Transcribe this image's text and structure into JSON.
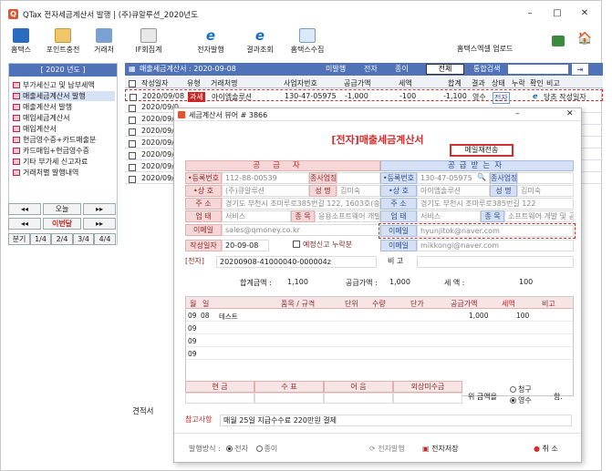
{
  "window": {
    "title": "QTax 전자세금계산서 발행 | (주)큐알루션_2020년도",
    "minimize": "–",
    "maximize": "□",
    "close": "✕"
  },
  "toolbar": {
    "items": [
      {
        "label": "홈택스",
        "icon": "hometax-icon"
      },
      {
        "label": "포인트충전",
        "icon": "point-charge-icon"
      },
      {
        "label": "거래처",
        "icon": "partner-icon"
      },
      {
        "label": "IF회집계",
        "icon": "aggregate-icon"
      },
      {
        "label": "전자발행",
        "icon": "e-issue-icon"
      },
      {
        "label": "결과조회",
        "icon": "result-query-icon"
      },
      {
        "label": "홈택스수집",
        "icon": "hometax-collect-icon"
      }
    ],
    "excel_upload": "홈택스엑셀 업로드",
    "home": "🏠"
  },
  "sidebar": {
    "year": "[ 2020 년도 ]",
    "items": [
      "부가세신고 및 납부세액",
      "매출세금계산서 발행",
      "매출계산서 발행",
      "매입세금계산서",
      "매입계산서",
      "현금영수증+카드매출분",
      "카드매입+현금영수증",
      "기타 부가세 신고자료",
      "거래처별 발행내역"
    ],
    "date_nav": {
      "prev": "◂◂",
      "today": "오늘",
      "next": "▸▸",
      "prev_month": "◂◂",
      "this_month": "이번달",
      "next_month": "▸▸",
      "quarters": [
        "분기",
        "1/4",
        "2/4",
        "3/4",
        "4/4"
      ]
    }
  },
  "list": {
    "header": "매출세금계산서 : 2020-09-08",
    "status_labels": [
      "미발행",
      "전자",
      "종이"
    ],
    "filter_selected": "전체",
    "search_label": "통합검색",
    "search_btn": "⇥",
    "columns": [
      "작성일자",
      "유형",
      "거래처명",
      "사업자번호",
      "공급가액",
      "세액",
      "합계",
      "결과",
      "상태",
      "누락",
      "확인",
      "비고"
    ],
    "rows": [
      {
        "date": "2020/09/08",
        "type": "과세",
        "partner": "아이엠솔루션",
        "bizno": "130-47-05975",
        "supply": "-1,000",
        "tax": "-100",
        "total": "-1,100",
        "result": "영수",
        "state": "전자",
        "note": "당초 작성일자"
      },
      {
        "date": "2020/09/0",
        "type": "",
        "partner": "",
        "bizno": "",
        "supply": "",
        "tax": "",
        "total": "",
        "result": "",
        "state": "",
        "note": ""
      },
      {
        "date": "2020/09/0",
        "type": "",
        "partner": "",
        "bizno": "",
        "supply": "",
        "tax": "",
        "total": "",
        "result": "",
        "state": "",
        "note": ""
      },
      {
        "date": "2020/09/0",
        "type": "",
        "partner": "",
        "bizno": "",
        "supply": "",
        "tax": "",
        "total": "",
        "result": "",
        "state": "",
        "note": ""
      },
      {
        "date": "2020/09/0",
        "type": "",
        "partner": "",
        "bizno": "",
        "supply": "",
        "tax": "",
        "total": "",
        "result": "",
        "state": "",
        "note": ""
      },
      {
        "date": "2020/09/0",
        "type": "",
        "partner": "",
        "bizno": "",
        "supply": "",
        "tax": "",
        "total": "",
        "result": "",
        "state": "",
        "note": ""
      },
      {
        "date": "2020/09/0",
        "type": "",
        "partner": "",
        "bizno": "",
        "supply": "",
        "tax": "",
        "total": "",
        "result": "",
        "state": "",
        "note": ""
      },
      {
        "date": "2020/09/0",
        "type": "",
        "partner": "",
        "bizno": "",
        "supply": "",
        "tax": "",
        "total": "",
        "result": "",
        "state": "",
        "note": ""
      }
    ],
    "footer_label": "견적서"
  },
  "viewer": {
    "title": "세금계산서 뷰어 # 3866",
    "heading": "[전자]매출세금계산서",
    "resend": "메일재전송",
    "supplier_header": "공급자",
    "buyer_header": "공급받는자",
    "supplier": {
      "regno_label": "•등록번호",
      "regno": "112-88-00539",
      "subno_label": "종사업장",
      "name_label": "•상 호",
      "name": "(주)큐알루션",
      "ceo_label": "성 명",
      "ceo": "김미숙",
      "addr_label": "주 소",
      "addr": "경기도 부천시 조마루로385번길 122, 1603호(송의동",
      "biz_label": "업 태",
      "biz": "서비스",
      "item_label": "종 목",
      "item": "응용소프트웨어 개발",
      "email_label": "이메일",
      "email": "sales@qmoney.co.kr"
    },
    "buyer": {
      "regno_label": "•등록번호",
      "regno": "130-47-05975",
      "subno_label": "종사업장",
      "name_label": "•상 호",
      "name": "아이엠솔루션",
      "ceo_label": "성 명",
      "ceo": "김미숙",
      "addr_label": "주 소",
      "addr": "경기도 부천시 조마루로385번길 122",
      "biz_label": "업 태",
      "biz": "서비스",
      "item_label": "종 목",
      "item": "소프트웨어 개발 및 공",
      "email1_label": "이메일",
      "email1": "hyunjitok@naver.com",
      "email2_label": "이메일",
      "email2": "mikkongi@naver.com"
    },
    "write_date_label": "작성일자",
    "write_date": "20-09-08",
    "reserve_label": "예정신고 누락분",
    "doc_label": "[전자]",
    "doc_no": "20200908-41000040-000004z",
    "remark_label": "비 고",
    "summary": {
      "total_label": "합계금액 :",
      "total": "1,100",
      "supply_label": "공급가액 :",
      "supply": "1,000",
      "tax_label": "세 액 :",
      "tax": "100"
    },
    "item_columns": [
      "월",
      "일",
      "품목 / 규격",
      "단위",
      "수량",
      "단가",
      "공급가액",
      "세액",
      "비고"
    ],
    "items": [
      {
        "m": "09",
        "d": "08",
        "name": "테스트",
        "supply": "1,000",
        "tax": "100"
      },
      {
        "m": "09",
        "d": "",
        "name": "",
        "supply": "",
        "tax": ""
      },
      {
        "m": "09",
        "d": "",
        "name": "",
        "supply": "",
        "tax": ""
      },
      {
        "m": "09",
        "d": "",
        "name": "",
        "supply": "",
        "tax": ""
      }
    ],
    "pay_columns": [
      "현 금",
      "수 표",
      "어 음",
      "외상미수금"
    ],
    "amount_label": "위 금액을",
    "claim": "청구",
    "receipt": "영수",
    "ham": "함.",
    "memo_label": "참고사항",
    "memo": "매월 25일 지급수수료 220만원 결제",
    "method_label": "발행방식 :",
    "method_electronic": "전자",
    "method_paper": "종이",
    "btn_e_issue": "전자발행",
    "btn_save": "전자저장",
    "btn_cancel": "취 소"
  }
}
